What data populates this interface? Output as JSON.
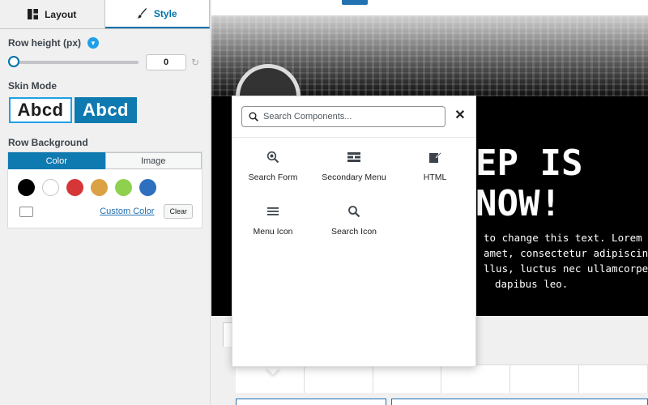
{
  "tabs": {
    "layout": "Layout",
    "style": "Style"
  },
  "row_height": {
    "label": "Row height (px)",
    "value": "0",
    "badge": "icon"
  },
  "skin_mode": {
    "label": "Skin Mode",
    "light": "Abcd",
    "dark": "Abcd"
  },
  "row_background": {
    "label": "Row Background",
    "tabs": [
      "Color",
      "Image"
    ],
    "swatches": [
      "#000000",
      "#ffffff",
      "#d63638",
      "#dba145",
      "#8ed14f",
      "#2e6fbf"
    ],
    "custom_color": "Custom Color",
    "clear": "Clear"
  },
  "hero": {
    "title_line1": "EP IS",
    "title_line2": "NOW!",
    "text_lines": [
      "to change this text. Lorem",
      "amet, consectetur adipiscing",
      "llus, luctus nec ullamcorper",
      "dapibus leo."
    ]
  },
  "popup": {
    "search_placeholder": "Search Components...",
    "components": [
      {
        "label": "Search Form",
        "icon": "search-form-icon"
      },
      {
        "label": "Secondary Menu",
        "icon": "secondary-menu-icon"
      },
      {
        "label": "HTML",
        "icon": "html-edit-icon"
      },
      {
        "label": "Menu Icon",
        "icon": "hamburger-menu-icon"
      },
      {
        "label": "Search Icon",
        "icon": "search-icon"
      }
    ]
  },
  "colors": {
    "accent": "#0073aa",
    "skin_dark": "#0f7ab0",
    "badge": "#1fa0e8"
  }
}
